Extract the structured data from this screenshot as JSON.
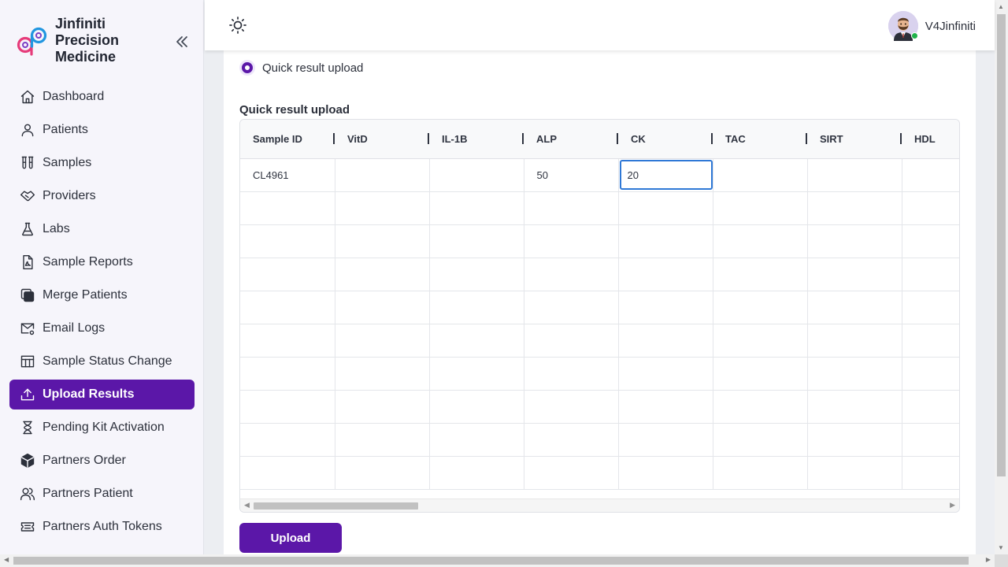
{
  "brand": {
    "name": "Jinfiniti Precision Medicine",
    "line1": "Jinfiniti",
    "line2": "Precision",
    "line3": "Medicine"
  },
  "sidebar": {
    "items": [
      {
        "label": "Dashboard",
        "icon": "home-icon"
      },
      {
        "label": "Patients",
        "icon": "user-icon"
      },
      {
        "label": "Samples",
        "icon": "test-tubes-icon"
      },
      {
        "label": "Providers",
        "icon": "handshake-icon"
      },
      {
        "label": "Labs",
        "icon": "flask-icon"
      },
      {
        "label": "Sample Reports",
        "icon": "pdf-file-icon"
      },
      {
        "label": "Merge Patients",
        "icon": "merge-icon"
      },
      {
        "label": "Email Logs",
        "icon": "mail-settings-icon"
      },
      {
        "label": "Sample Status Change",
        "icon": "table-icon"
      },
      {
        "label": "Upload Results",
        "icon": "upload-icon",
        "active": true
      },
      {
        "label": "Pending Kit Activation",
        "icon": "hourglass-icon"
      },
      {
        "label": "Partners Order",
        "icon": "box-icon"
      },
      {
        "label": "Partners Patient",
        "icon": "users-icon"
      },
      {
        "label": "Partners Auth Tokens",
        "icon": "ticket-icon"
      }
    ]
  },
  "header": {
    "username": "V4Jinfiniti"
  },
  "main": {
    "radio_label": "Quick result upload",
    "section_title": "Quick result upload",
    "upload_label": "Upload"
  },
  "table": {
    "columns": [
      "Sample ID",
      "VitD",
      "IL-1B",
      "ALP",
      "CK",
      "TAC",
      "SIRT",
      "HDL"
    ],
    "rows": [
      [
        "CL4961",
        "",
        "",
        "50",
        "20",
        "",
        "",
        ""
      ],
      [
        "",
        "",
        "",
        "",
        "",
        "",
        "",
        ""
      ],
      [
        "",
        "",
        "",
        "",
        "",
        "",
        "",
        ""
      ],
      [
        "",
        "",
        "",
        "",
        "",
        "",
        "",
        ""
      ],
      [
        "",
        "",
        "",
        "",
        "",
        "",
        "",
        ""
      ],
      [
        "",
        "",
        "",
        "",
        "",
        "",
        "",
        ""
      ],
      [
        "",
        "",
        "",
        "",
        "",
        "",
        "",
        ""
      ],
      [
        "",
        "",
        "",
        "",
        "",
        "",
        "",
        ""
      ],
      [
        "",
        "",
        "",
        "",
        "",
        "",
        "",
        ""
      ],
      [
        "",
        "",
        "",
        "",
        "",
        "",
        "",
        ""
      ]
    ],
    "editing_cell": {
      "row": 0,
      "col": 4
    }
  },
  "colors": {
    "accent": "#5b17a8",
    "focus": "#2f78d6",
    "online": "#1fb24a"
  }
}
